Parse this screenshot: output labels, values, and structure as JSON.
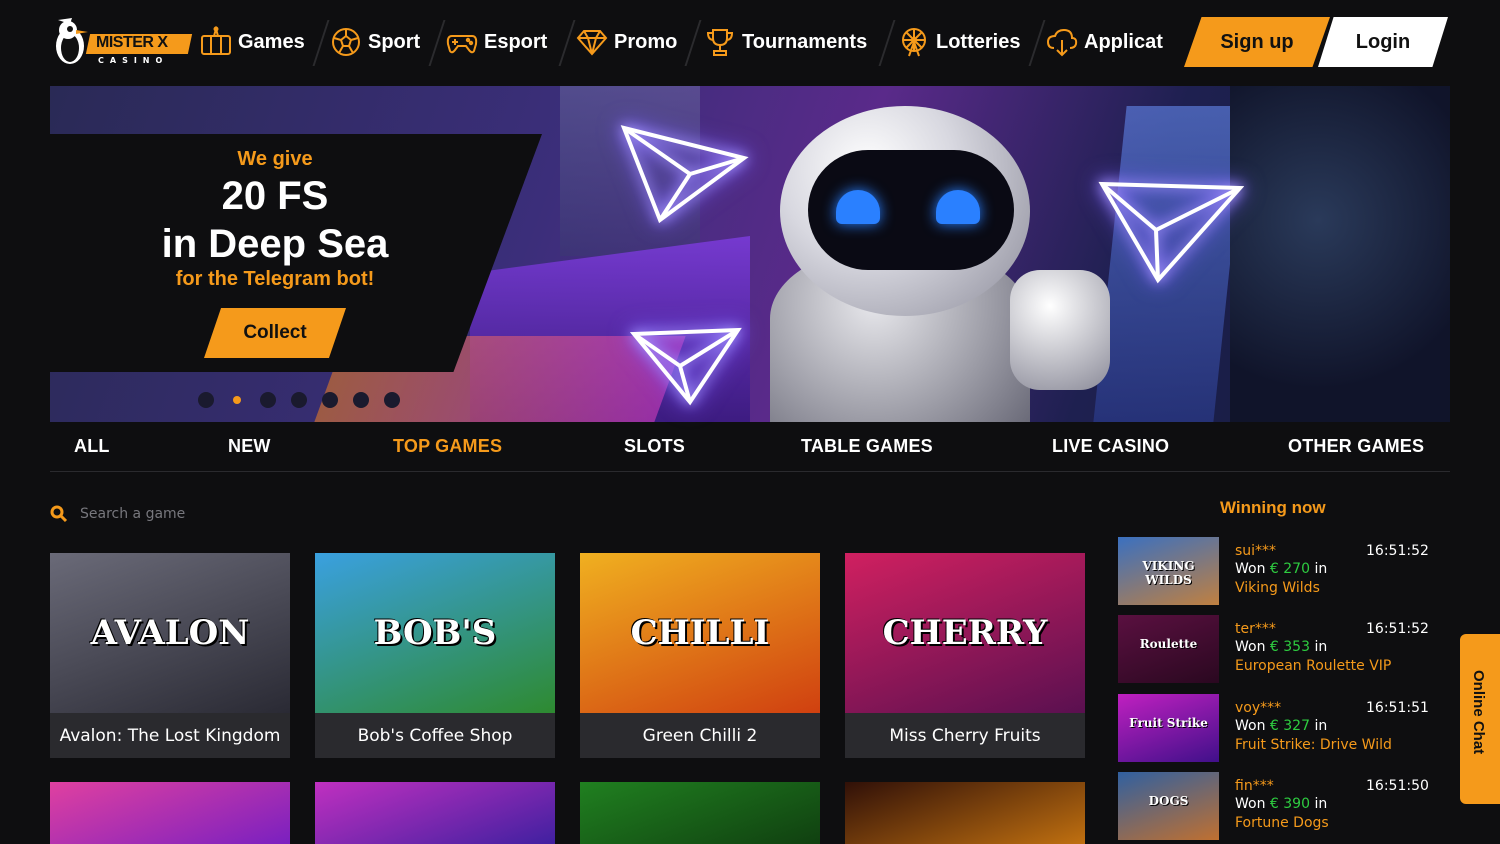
{
  "brand": {
    "name": "MISTER X",
    "sub": "CASINO"
  },
  "nav": [
    {
      "label": "Games",
      "icon": "slot-machine-icon"
    },
    {
      "label": "Sport",
      "icon": "soccer-ball-icon"
    },
    {
      "label": "Esport",
      "icon": "gamepad-icon"
    },
    {
      "label": "Promo",
      "icon": "diamond-icon"
    },
    {
      "label": "Tournaments",
      "icon": "trophy-icon"
    },
    {
      "label": "Lotteries",
      "icon": "ferris-wheel-icon"
    },
    {
      "label": "Applicat",
      "icon": "cloud-download-icon"
    }
  ],
  "auth": {
    "signup": "Sign up",
    "login": "Login"
  },
  "banner": {
    "line1": "We give",
    "line2": "20 FS",
    "line3": "in Deep Sea",
    "line4": "for the Telegram bot!",
    "cta": "Collect",
    "slides": 7,
    "active_slide": 2
  },
  "tabs": [
    "ALL",
    "NEW",
    "TOP GAMES",
    "SLOTS",
    "TABLE GAMES",
    "LIVE CASINO",
    "OTHER GAMES"
  ],
  "active_tab": "TOP GAMES",
  "search": {
    "placeholder": "Search a game"
  },
  "games": [
    {
      "name": "Avalon: The Lost Kingdom",
      "art": "AVALON",
      "colors": [
        "#6a6a78",
        "#2a2a34"
      ]
    },
    {
      "name": "Bob's Coffee Shop",
      "art": "BOB'S",
      "colors": [
        "#3aa0e0",
        "#2e8a30"
      ]
    },
    {
      "name": "Green Chilli 2",
      "art": "CHILLI",
      "colors": [
        "#f0b020",
        "#d04010"
      ]
    },
    {
      "name": "Miss Cherry Fruits",
      "art": "CHERRY",
      "colors": [
        "#d02060",
        "#5a1050"
      ]
    }
  ],
  "games_row2": [
    {
      "colors": [
        "#e040a0",
        "#7a20c0"
      ]
    },
    {
      "colors": [
        "#c030c0",
        "#4020a0"
      ]
    },
    {
      "colors": [
        "#208020",
        "#104010"
      ]
    },
    {
      "colors": [
        "#301008",
        "#c07010"
      ]
    }
  ],
  "winning": {
    "title": "Winning now",
    "currency": "€",
    "rows": [
      {
        "user": "sui***",
        "time": "16:51:52",
        "won": "Won",
        "amount": "€ 270",
        "in": "in",
        "game": "Viking Wilds",
        "art": "VIKING WILDS",
        "colors": [
          "#3a70c0",
          "#c08040"
        ]
      },
      {
        "user": "ter***",
        "time": "16:51:52",
        "won": "Won",
        "amount": "€ 353",
        "in": "in",
        "game": "European Roulette VIP",
        "art": "Roulette",
        "colors": [
          "#5a1040",
          "#2a0820"
        ]
      },
      {
        "user": "voy***",
        "time": "16:51:51",
        "won": "Won",
        "amount": "€ 327",
        "in": "in",
        "game": "Fruit Strike: Drive Wild",
        "art": "Fruit Strike",
        "colors": [
          "#c020c0",
          "#40108a"
        ]
      },
      {
        "user": "fin***",
        "time": "16:51:50",
        "won": "Won",
        "amount": "€ 390",
        "in": "in",
        "game": "Fortune Dogs",
        "art": "DOGS",
        "colors": [
          "#3060a0",
          "#c07030"
        ]
      }
    ]
  },
  "chat": {
    "label": "Online Chat"
  }
}
